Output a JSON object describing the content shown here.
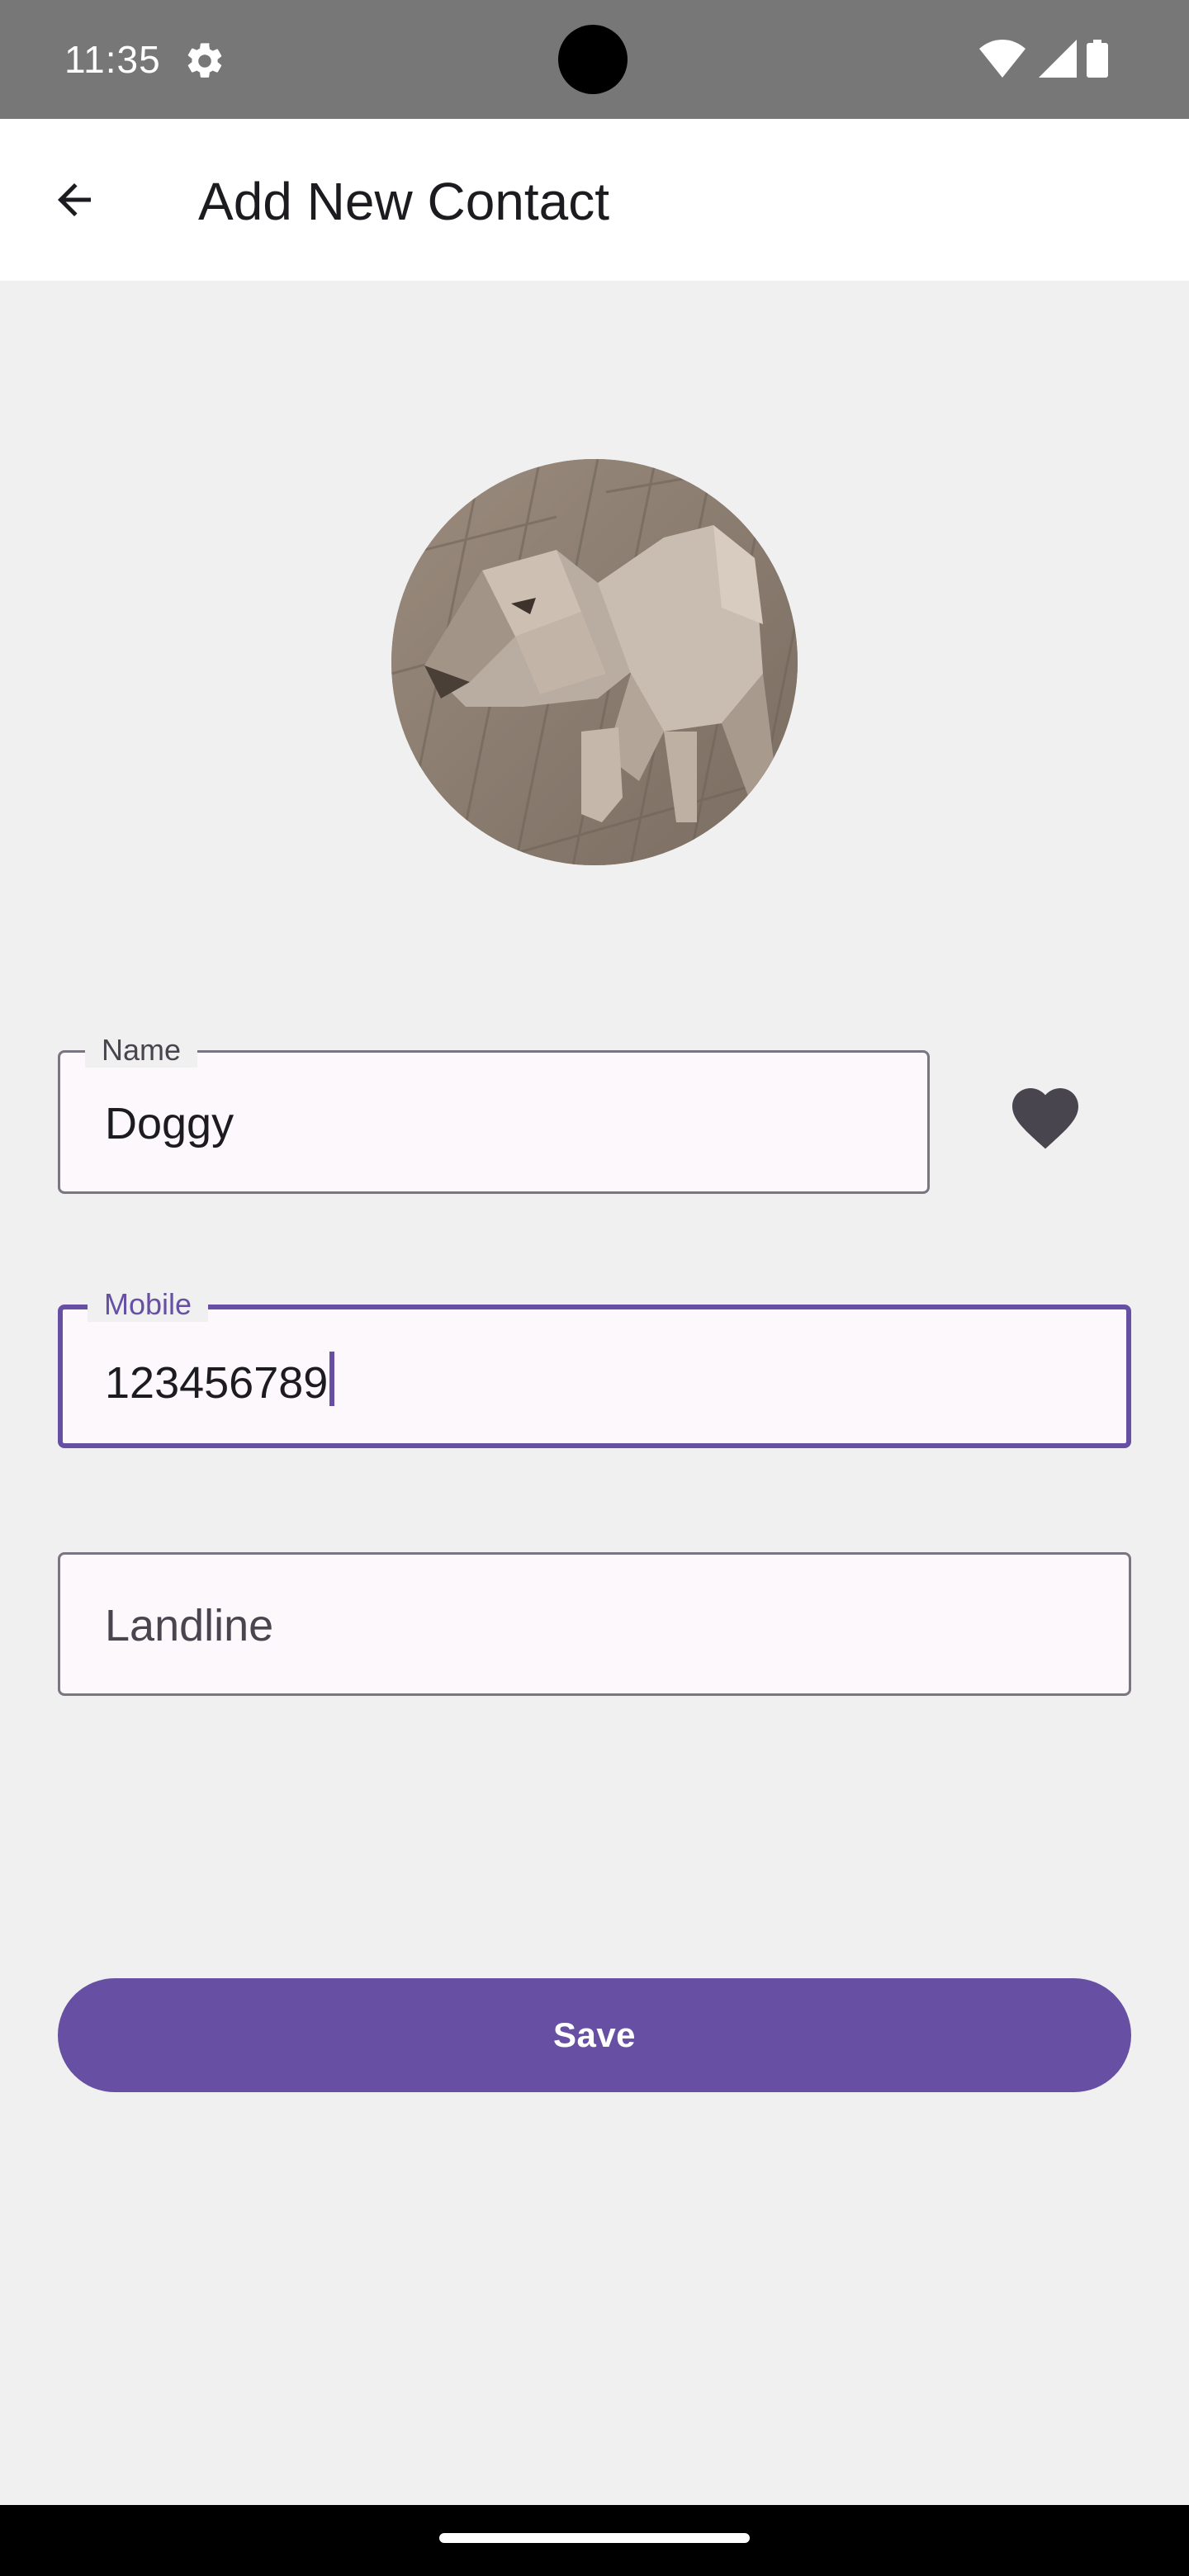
{
  "status_bar": {
    "time": "11:35",
    "icons": [
      "settings-gear-icon",
      "wifi-icon",
      "cellular-signal-icon",
      "battery-icon"
    ]
  },
  "app_bar": {
    "title": "Add New Contact",
    "back_icon": "arrow-back-icon"
  },
  "avatar": {
    "description": "contact-photo"
  },
  "form": {
    "name": {
      "label": "Name",
      "value": "Doggy"
    },
    "favorite": {
      "icon": "heart-icon",
      "filled": true
    },
    "mobile": {
      "label": "Mobile",
      "value": "123456789",
      "focused": true
    },
    "landline": {
      "placeholder": "Landline",
      "value": ""
    }
  },
  "actions": {
    "save_label": "Save"
  },
  "colors": {
    "primary": "#6750a4",
    "background": "#f0f0f0",
    "status_bar": "#777777",
    "app_bar": "#ffffff",
    "heart": "#49454f"
  }
}
